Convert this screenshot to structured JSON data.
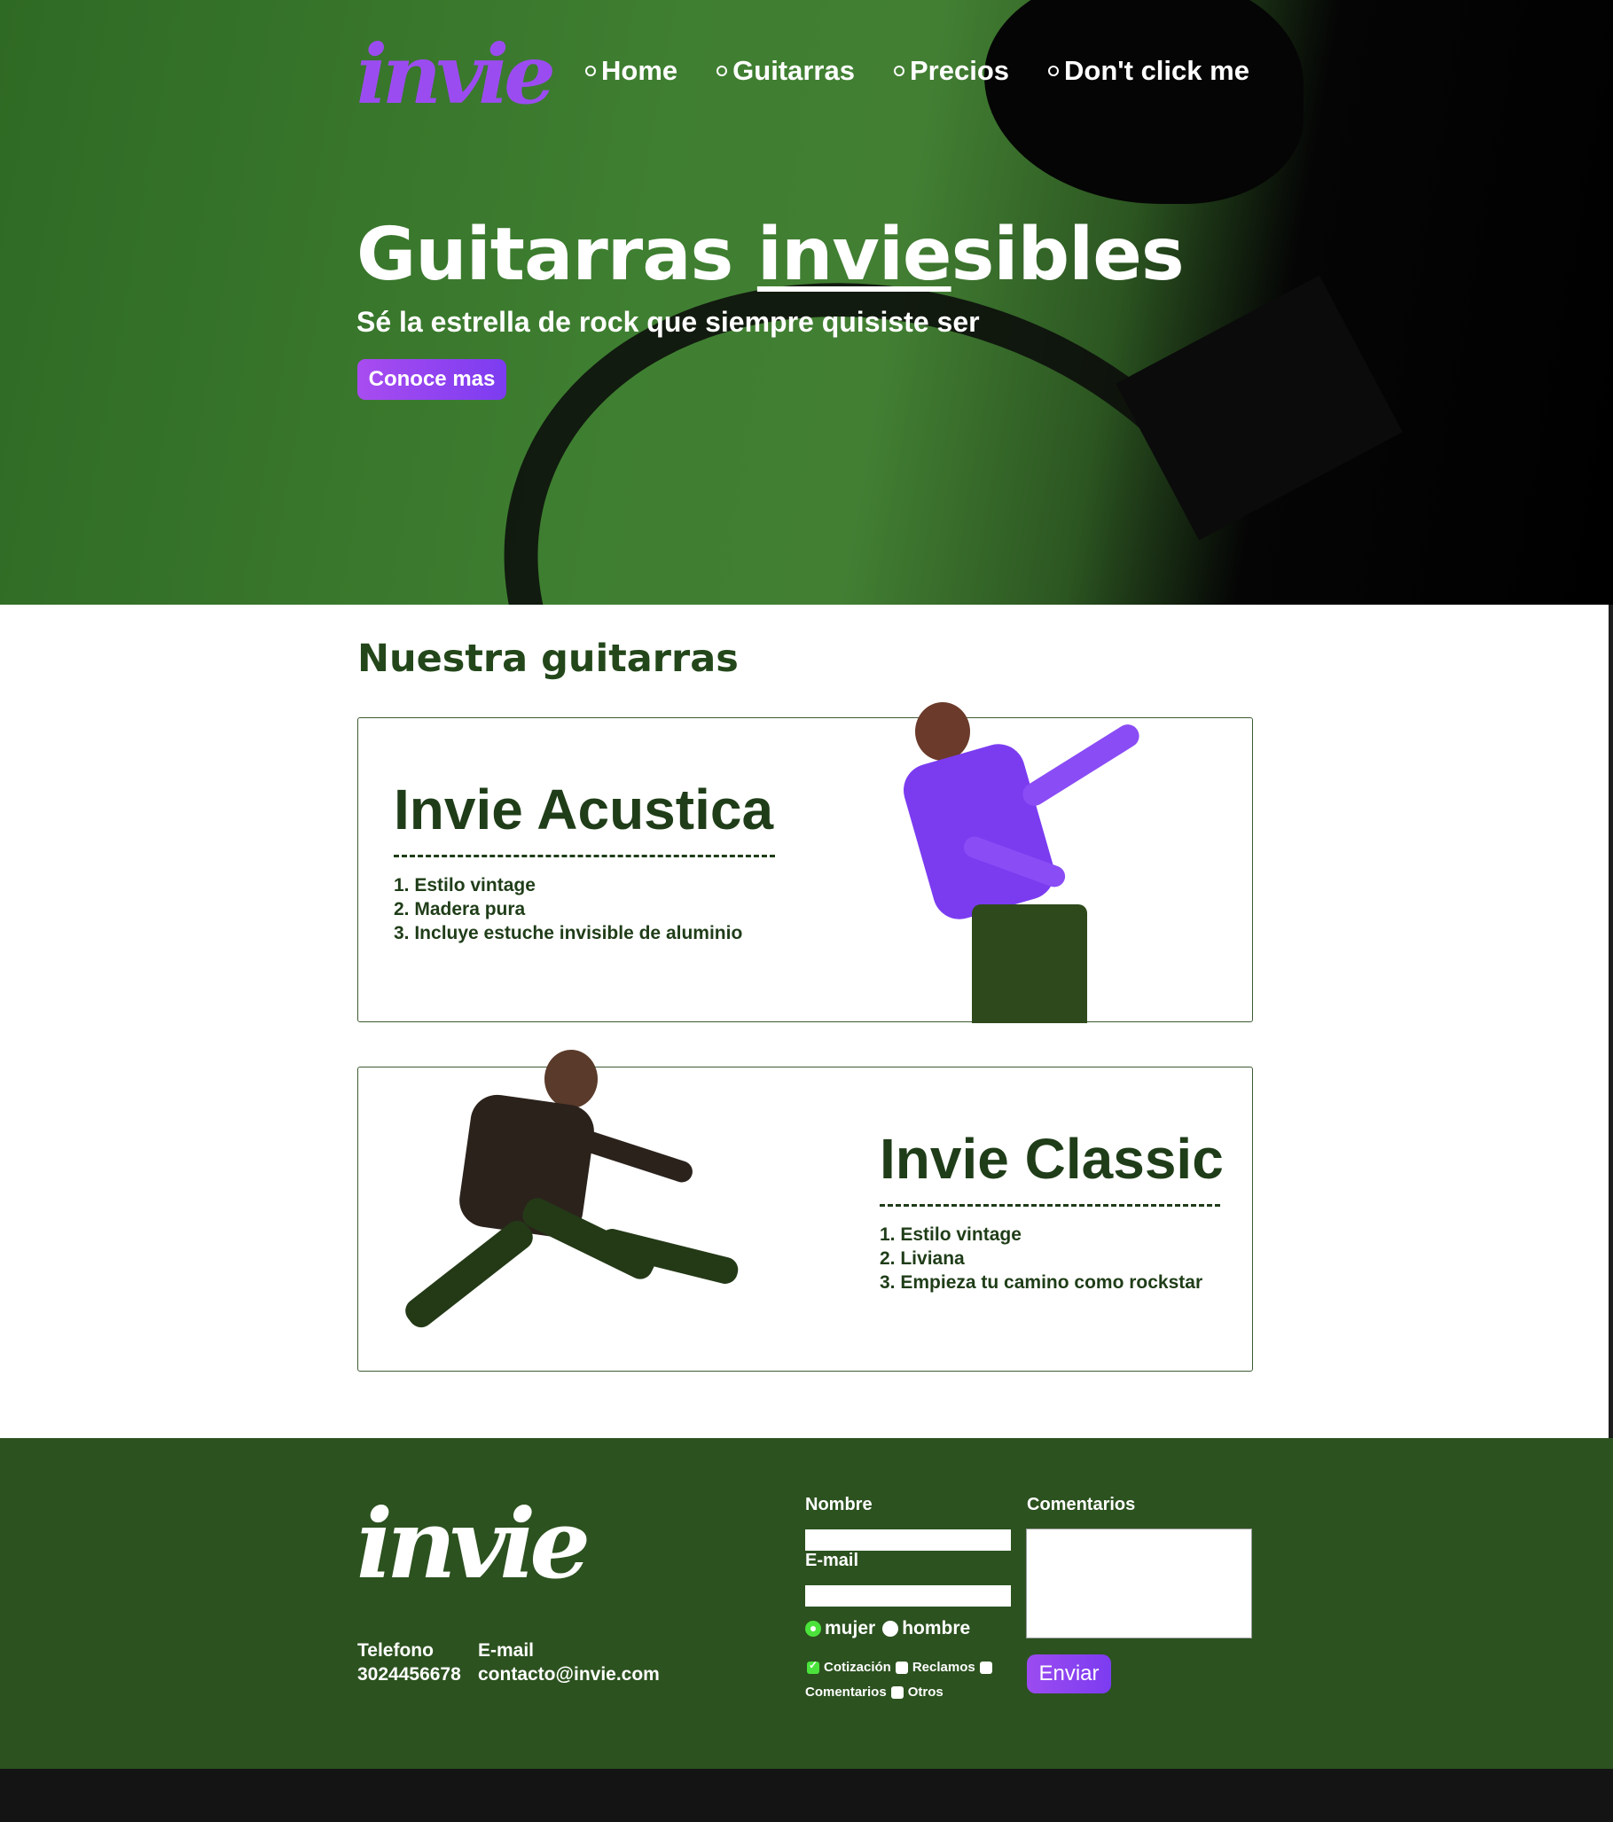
{
  "brand": {
    "logo_text": "invie",
    "accent": "#9b4cf0",
    "hero_green": "#427f33",
    "footer_green": "#2c521f",
    "text_green": "#1f3d18"
  },
  "nav": {
    "items": [
      {
        "label": "Home"
      },
      {
        "label": "Guitarras"
      },
      {
        "label": "Precios"
      },
      {
        "label": "Don't click me"
      }
    ]
  },
  "hero": {
    "title_prefix": "Guitarras ",
    "title_underlined": "invie",
    "title_suffix": "sibles",
    "subtitle": "Sé la estrella de rock que siempre quisiste ser",
    "cta_label": "Conoce mas"
  },
  "products": {
    "section_title": "Nuestra guitarras",
    "cards": [
      {
        "title": "Invie Acustica",
        "features": [
          "1. Estilo vintage",
          "2. Madera pura",
          "3. Incluye estuche invisible de aluminio"
        ]
      },
      {
        "title": "Invie Classic",
        "features": [
          "1. Estilo vintage",
          "2. Liviana",
          "3. Empieza tu camino como rockstar"
        ]
      }
    ]
  },
  "footer": {
    "logo_text": "invie",
    "phone_label": "Telefono",
    "phone_value": "3024456678",
    "email_label": "E-mail",
    "email_value": "contacto@invie.com",
    "form": {
      "name_label": "Nombre",
      "email_label": "E-mail",
      "comments_label": "Comentarios",
      "radio_options": [
        "mujer",
        "hombre"
      ],
      "radio_selected": "mujer",
      "checkbox_options": [
        "Cotización",
        "Reclamos",
        "Comentarios",
        "Otros"
      ],
      "checkbox_checked": [
        "Cotización"
      ],
      "submit_label": "Enviar"
    }
  }
}
